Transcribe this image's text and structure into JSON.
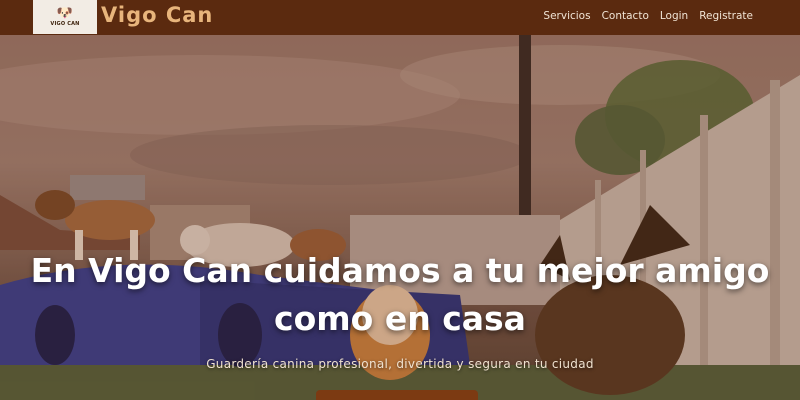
{
  "brand": {
    "logo_text": "VIGO CAN",
    "name": "Vigo Can"
  },
  "nav": {
    "items": [
      {
        "label": "Servicios"
      },
      {
        "label": "Contacto"
      },
      {
        "label": "Login"
      },
      {
        "label": "Registrate"
      }
    ]
  },
  "hero": {
    "title": "En Vigo Can cuidamos a tu mejor amigo como en casa",
    "subtitle": "Guardería canina profesional, divertida y segura en tu ciudad",
    "cta_label": ""
  },
  "colors": {
    "navbar_bg": "#5b2a0f",
    "brand_accent": "#e8b57c",
    "cta_bg": "#7c3a12"
  }
}
